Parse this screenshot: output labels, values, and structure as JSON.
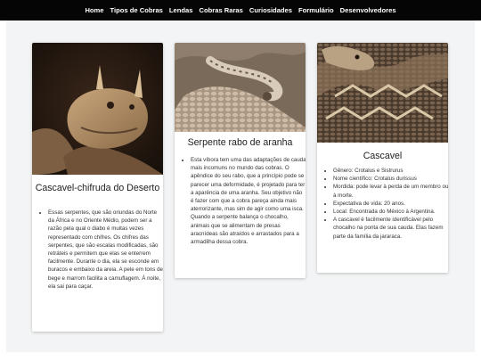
{
  "nav": {
    "items": [
      "Home",
      "Tipos de Cobras",
      "Lendas",
      "Cobras Raras",
      "Curiosidades",
      "Formulário",
      "Desenvolvedores"
    ]
  },
  "cards": [
    {
      "image": "horned-viper-photo",
      "title": "Cascavel-chifruda do Deserto",
      "bullets": [
        "Essas serpentes, que são oriundas do Norte da África e no Oriente Médio, podem ser a razão pela qual o diabo é muitas vezes representado com chifres. Os chifres das serpentes, que são escalas modificadas, são retráteis e permitem que elas se enterrem facilmente. Durante o dia, ela se esconde em buracos e embaixo da areia. A pele em tons de bege e marrom facilita a camuflagem. À noite, ela sai para caçar."
      ]
    },
    {
      "image": "spider-tailed-viper-photo",
      "title": "Serpente rabo de aranha",
      "bullets": [
        "Esta víbora tem uma das adaptações de cauda mais incomuns no mundo das cobras. O apêndice do seu rabo, que a princípio pode se parecer uma deformidade, é projetado para ter a aparência de uma aranha. Seu objetivo não é fazer com que a cobra pareça ainda mais aterrorizante, mas sim de agir como uma isca. Quando a serpente balança o chocalho, animais que se alimentam de presas aracnídeas são atraídos e arrastados para a armadilha dessa cobra."
      ]
    },
    {
      "image": "rattlesnake-photo",
      "title": "Cascavel",
      "bullets": [
        "Gênero: Crotalus e Sistrurus",
        "Nome científico: Crotalus durissus",
        "Mordida: pode levar à perda de um membro ou à morte.",
        "Expectativa de vida: 20 anos.",
        "Local: Encontrada do México à Argentina.",
        "A cascavel é facilmente identificável pelo chocalho na ponta de sua cauda. Elas fazem parte da família da jararaca."
      ]
    }
  ]
}
